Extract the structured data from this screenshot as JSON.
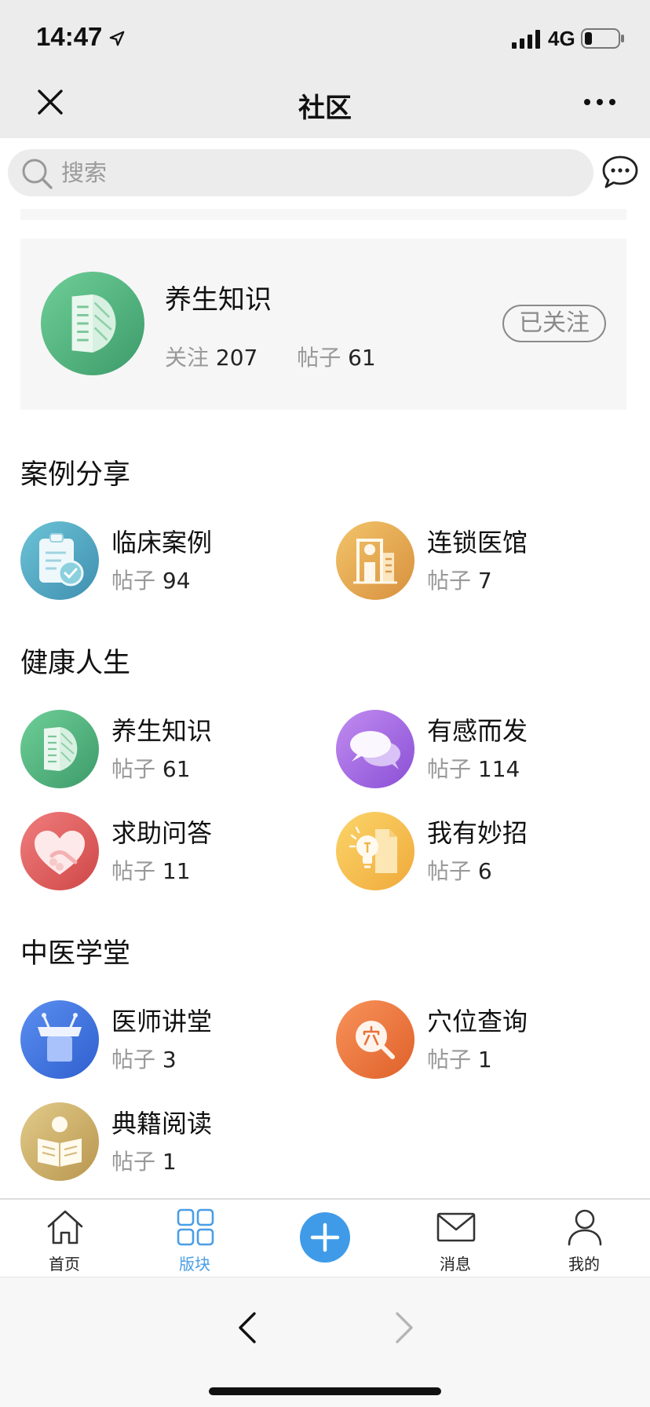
{
  "status": {
    "time": "14:47",
    "network": "4G"
  },
  "nav": {
    "title": "社区"
  },
  "search": {
    "placeholder": "搜索"
  },
  "featured": {
    "title": "养生知识",
    "follow_label": "关注",
    "follow_count": "207",
    "posts_label": "帖子",
    "posts_count": "61",
    "followed_button": "已关注"
  },
  "sections": [
    {
      "title": "案例分享",
      "items": [
        {
          "name": "临床案例",
          "posts_label": "帖子",
          "posts": "94",
          "icon": "clipboard-check-icon"
        },
        {
          "name": "连锁医馆",
          "posts_label": "帖子",
          "posts": "7",
          "icon": "clinic-building-icon"
        }
      ]
    },
    {
      "title": "健康人生",
      "items": [
        {
          "name": "养生知识",
          "posts_label": "帖子",
          "posts": "61",
          "icon": "leaf-book-icon"
        },
        {
          "name": "有感而发",
          "posts_label": "帖子",
          "posts": "114",
          "icon": "speech-bubbles-icon"
        },
        {
          "name": "求助问答",
          "posts_label": "帖子",
          "posts": "11",
          "icon": "heart-hands-icon"
        },
        {
          "name": "我有妙招",
          "posts_label": "帖子",
          "posts": "6",
          "icon": "lightbulb-icon"
        }
      ]
    },
    {
      "title": "中医学堂",
      "items": [
        {
          "name": "医师讲堂",
          "posts_label": "帖子",
          "posts": "3",
          "icon": "lectern-icon"
        },
        {
          "name": "穴位查询",
          "posts_label": "帖子",
          "posts": "1",
          "icon": "acupoint-search-icon"
        },
        {
          "name": "典籍阅读",
          "posts_label": "帖子",
          "posts": "1",
          "icon": "reading-person-icon"
        }
      ]
    }
  ],
  "tabbar": {
    "home": "首页",
    "boards": "版块",
    "messages": "消息",
    "mine": "我的"
  },
  "colors": {
    "accent": "#3f9be8",
    "muted": "#999999"
  }
}
